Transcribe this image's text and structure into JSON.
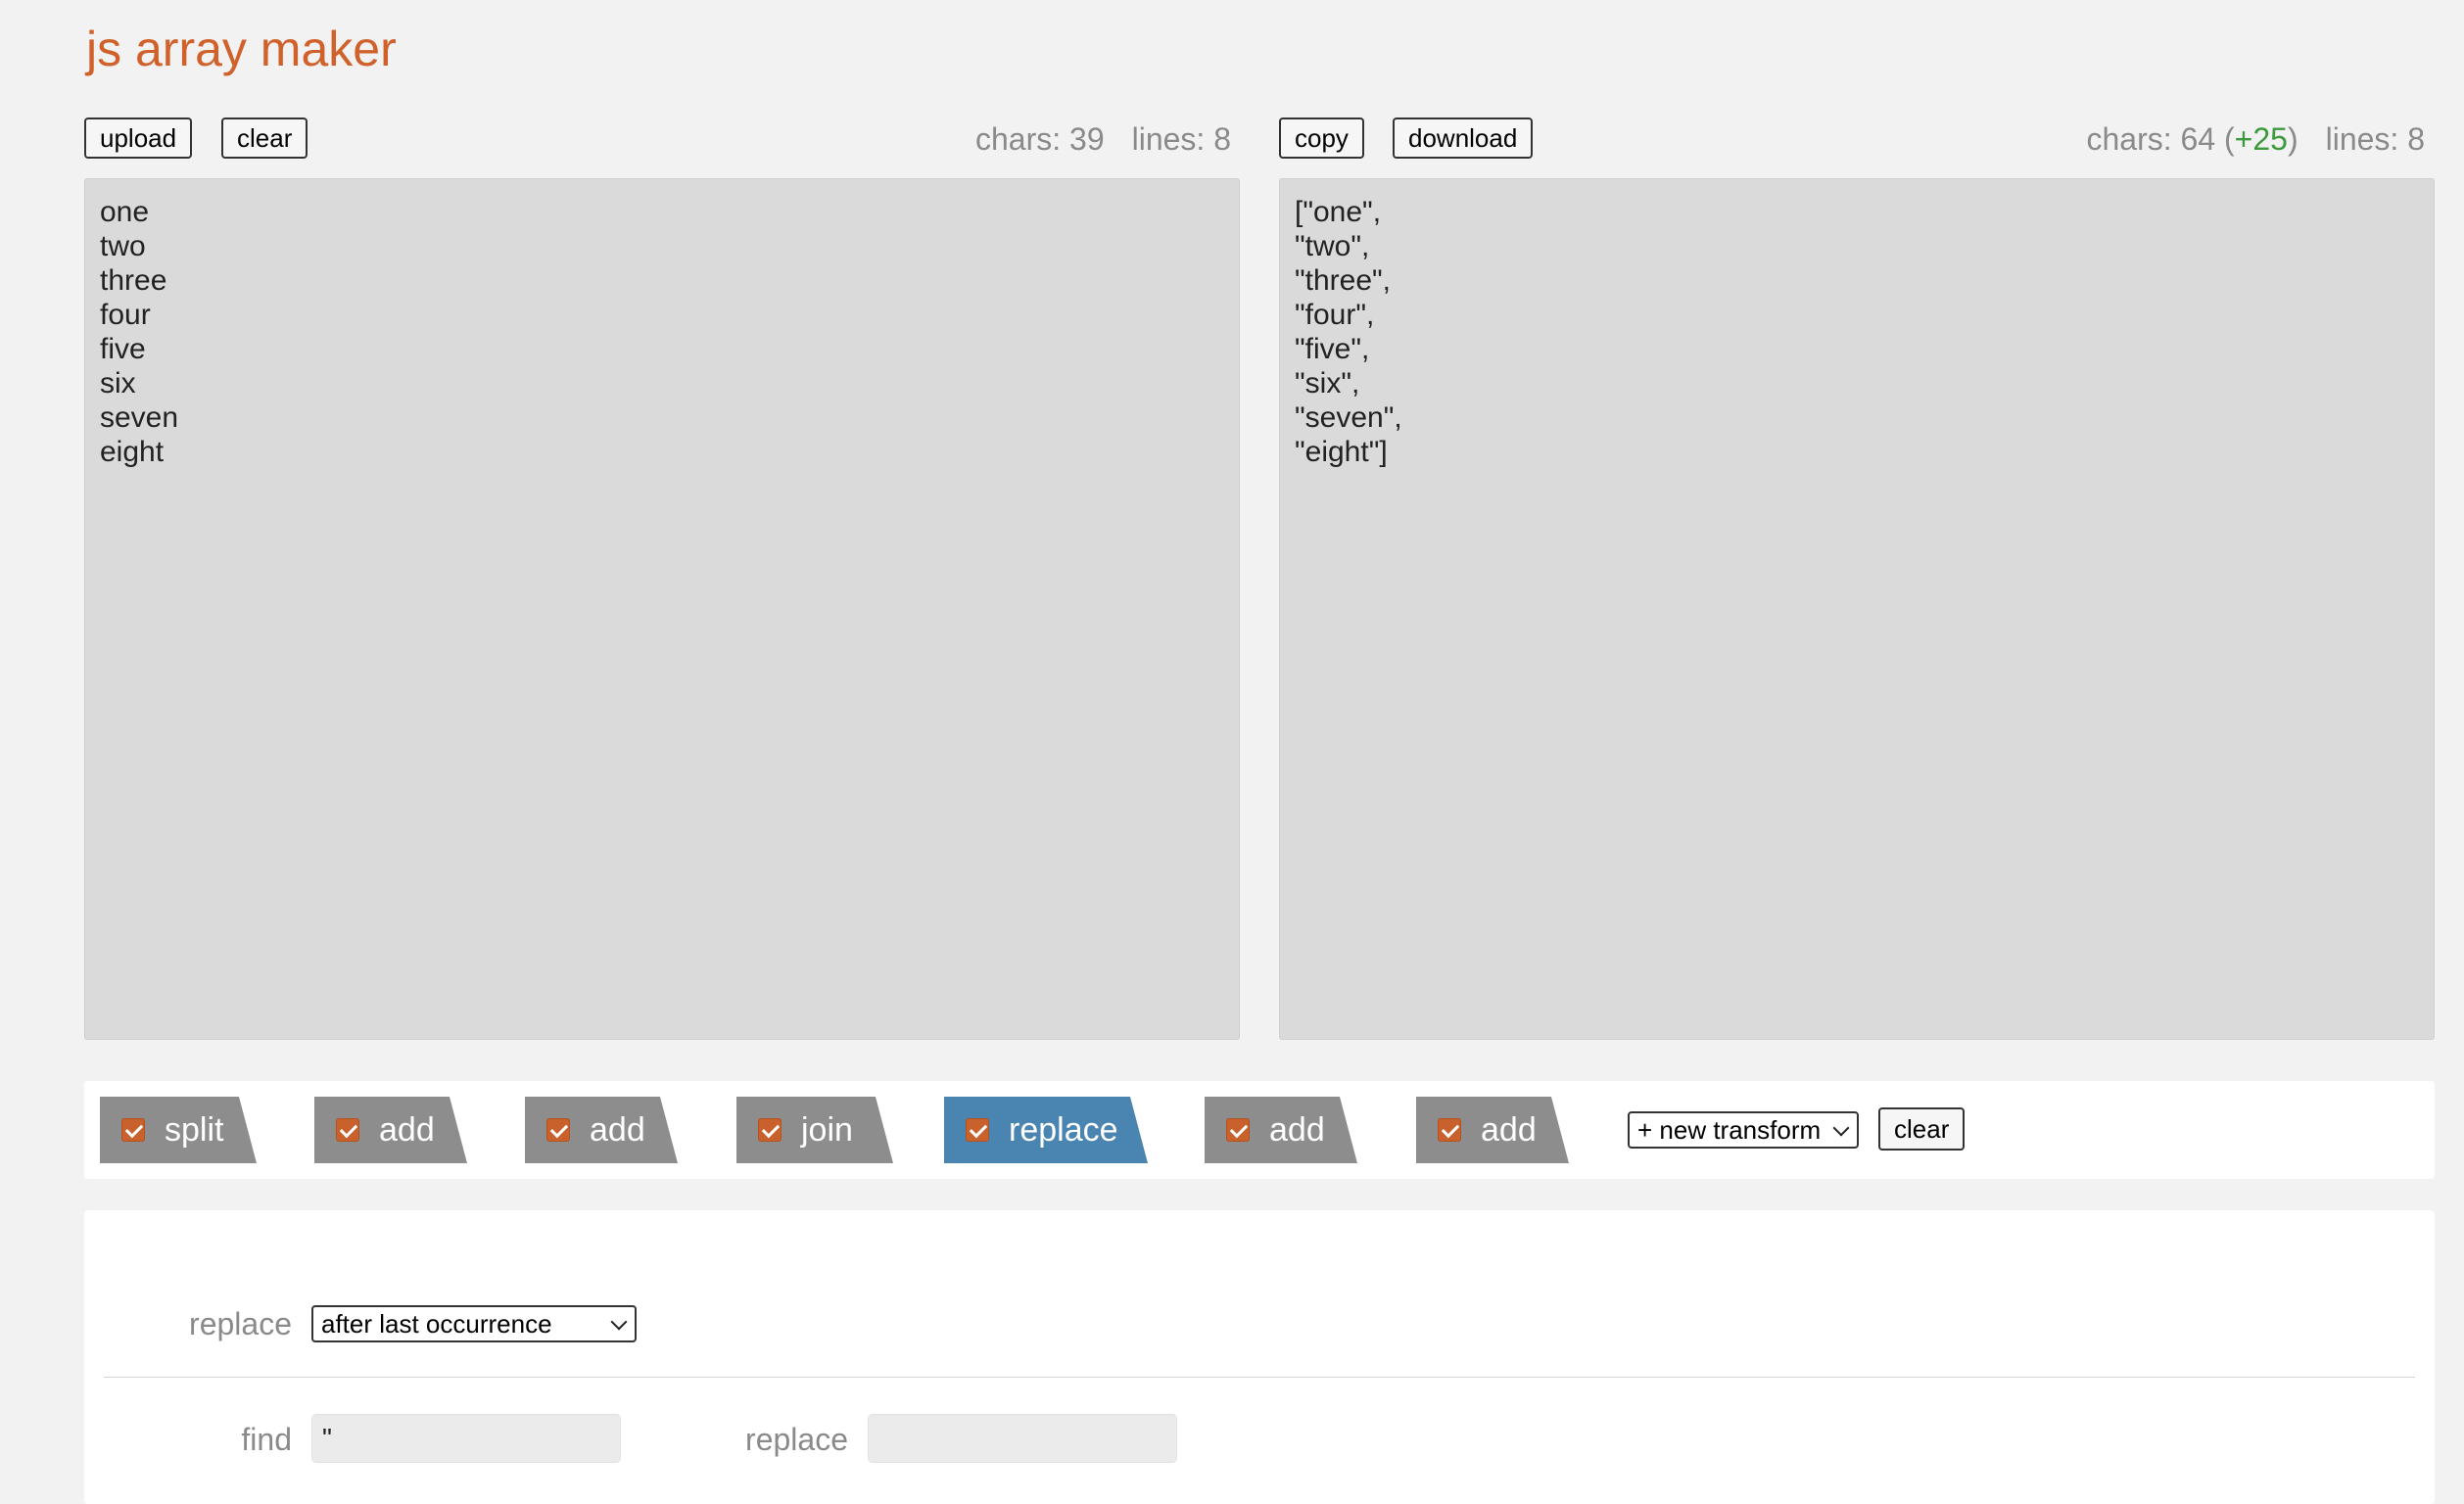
{
  "app": {
    "title": "js array maker"
  },
  "input": {
    "upload_label": "upload",
    "clear_label": "clear",
    "chars_label": "chars: 39",
    "lines_label": "lines: 8",
    "text": "one\ntwo\nthree\nfour\nfive\nsix\nseven\neight"
  },
  "output": {
    "copy_label": "copy",
    "download_label": "download",
    "chars_prefix": "chars: 64 (",
    "chars_delta": "+25",
    "chars_suffix": ")",
    "lines_label": "lines: 8",
    "text": "[\"one\",\n\"two\",\n\"three\",\n\"four\",\n\"five\",\n\"six\",\n\"seven\",\n\"eight\"]"
  },
  "transforms": {
    "tabs": [
      {
        "label": "split",
        "checked": true,
        "active": false
      },
      {
        "label": "add",
        "checked": true,
        "active": false
      },
      {
        "label": "add",
        "checked": true,
        "active": false
      },
      {
        "label": "join",
        "checked": true,
        "active": false
      },
      {
        "label": "replace",
        "checked": true,
        "active": true
      },
      {
        "label": "add",
        "checked": true,
        "active": false
      },
      {
        "label": "add",
        "checked": true,
        "active": false
      }
    ],
    "new_transform_label": "+ new transform",
    "clear_label": "clear"
  },
  "settings": {
    "mode_label": "replace",
    "mode_value": "after last occurrence",
    "find_label": "find",
    "find_value": "\"",
    "replace_label": "replace",
    "replace_value": ""
  },
  "colors": {
    "title": "#d0612a",
    "checkbox": "#c8612c",
    "tab_inactive": "#8d8d8d",
    "tab_active": "#4a84b0",
    "delta_green": "#3c9a3c"
  }
}
